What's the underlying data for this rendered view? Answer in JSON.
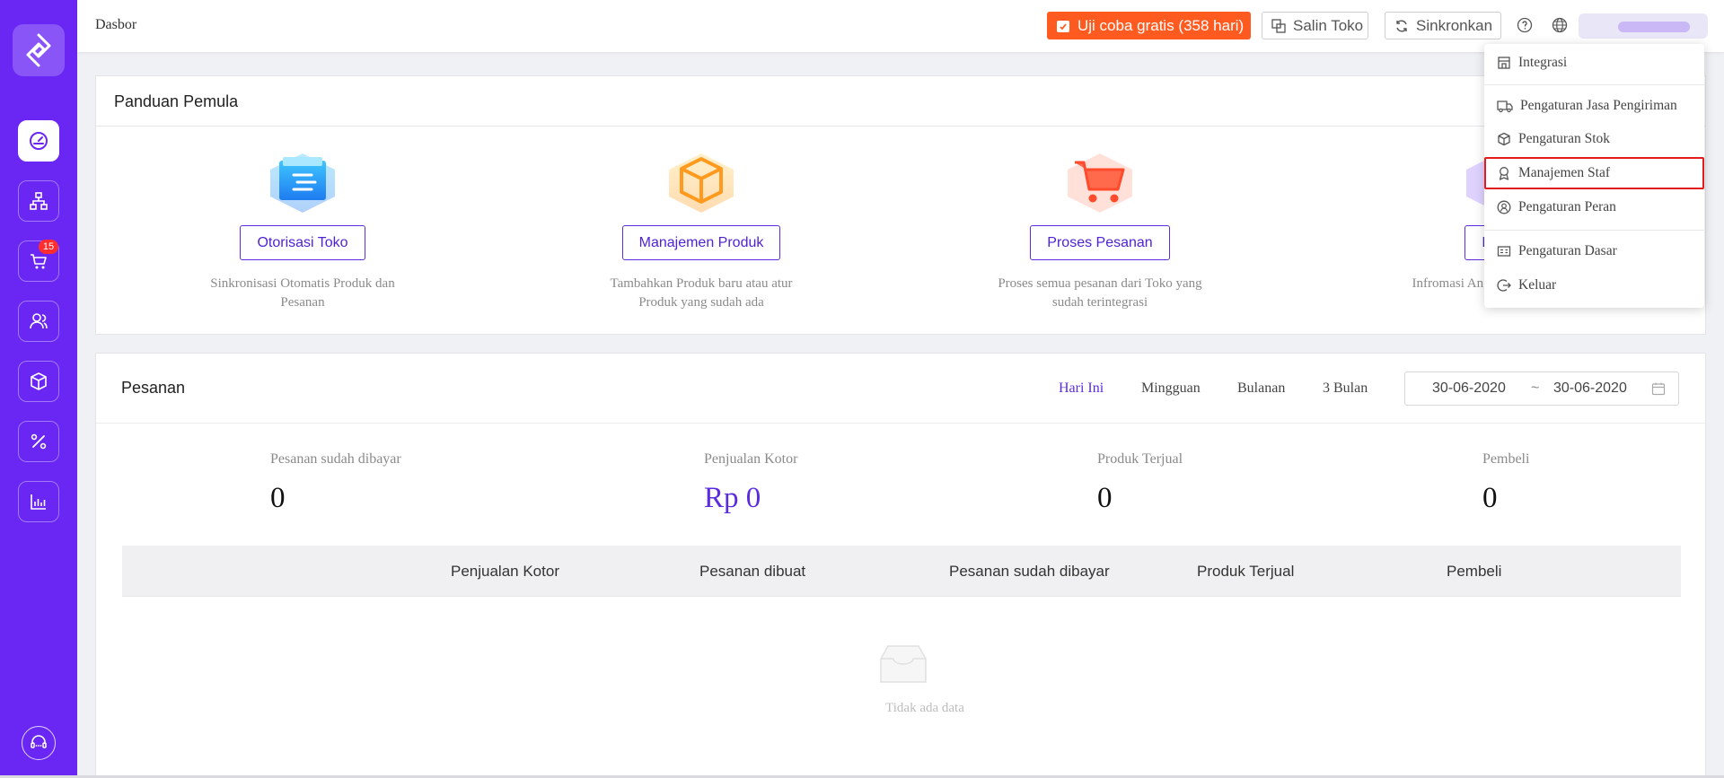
{
  "topbar": {
    "breadcrumb": "Dasbor",
    "trial_label": "Uji coba gratis (358 hari)",
    "copy_store_label": "Salin Toko",
    "sync_label": "Sinkronkan"
  },
  "sidebar": {
    "cart_badge": "15",
    "items": [
      "dashboard-icon",
      "org-chart-icon",
      "cart-icon",
      "users-icon",
      "box-icon",
      "percent-icon",
      "bar-chart-icon"
    ]
  },
  "guide": {
    "title": "Panduan Pemula",
    "items": [
      {
        "button": "Otorisasi Toko",
        "desc": "Sinkronisasi Otomatis Produk dan Pesanan"
      },
      {
        "button": "Manajemen Produk",
        "desc": "Tambahkan Produk baru atau atur Produk yang sudah ada"
      },
      {
        "button": "Proses Pesanan",
        "desc": "Proses semua pesanan dari Toko yang sudah terintegrasi"
      },
      {
        "button": "Kean",
        "desc": "Infromasi Ang Manajemen Poin"
      }
    ]
  },
  "orders": {
    "title": "Pesanan",
    "periods": [
      "Hari Ini",
      "Mingguan",
      "Bulanan",
      "3 Bulan"
    ],
    "active_period": "Hari Ini",
    "date_from": "30-06-2020",
    "date_sep": "~",
    "date_to": "30-06-2020",
    "stats": [
      {
        "label": "Pesanan sudah dibayar",
        "value": "0"
      },
      {
        "label": "Penjualan Kotor",
        "value": "Rp 0"
      },
      {
        "label": "Produk Terjual",
        "value": "0"
      },
      {
        "label": "Pembeli",
        "value": "0"
      }
    ],
    "columns": [
      "Penjualan Kotor",
      "Pesanan dibuat",
      "Pesanan sudah dibayar",
      "Produk Terjual",
      "Pembeli"
    ],
    "empty_text": "Tidak ada data"
  },
  "dropdown": {
    "items": [
      "Integrasi",
      "Pengaturan Jasa Pengiriman",
      "Pengaturan Stok",
      "Manajemen Staf",
      "Pengaturan Peran",
      "Pengaturan Dasar",
      "Keluar"
    ],
    "highlighted": "Manajemen Staf"
  },
  "colors": {
    "sidebar": "#6a27f3",
    "accent": "#5b2be0",
    "trial": "#ff5a1f",
    "highlight_border": "#e31b1b"
  }
}
